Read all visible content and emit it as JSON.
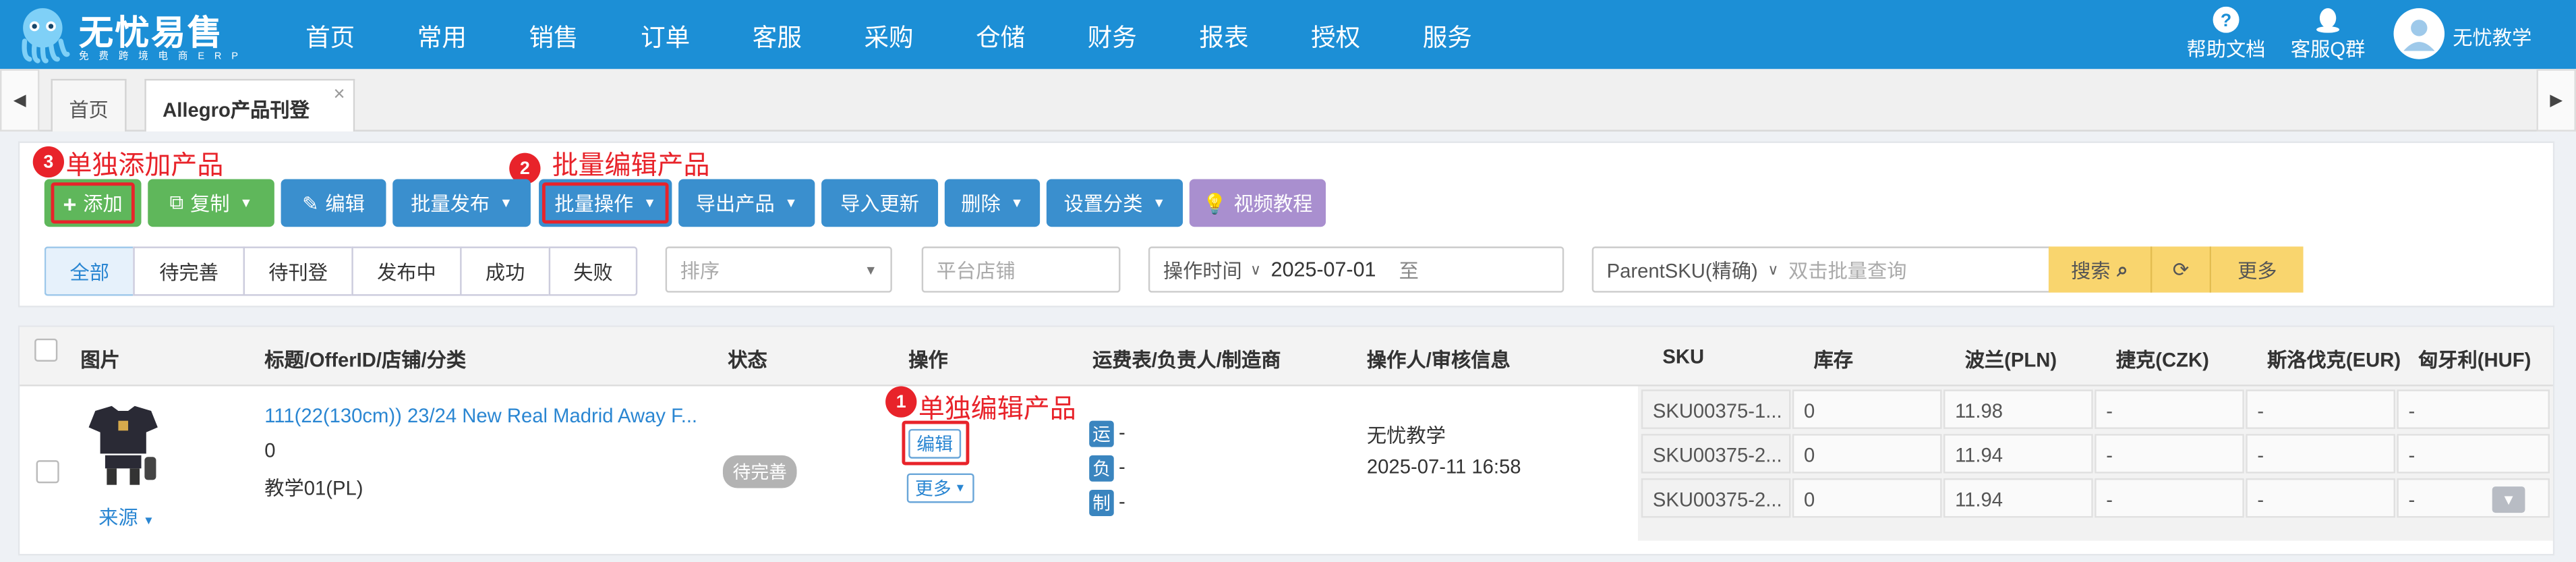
{
  "app": {
    "title": "无忧易售",
    "subtitle": "免 费 跨 境 电 商 E R P"
  },
  "nav": [
    "首页",
    "常用",
    "销售",
    "订单",
    "客服",
    "采购",
    "仓储",
    "财务",
    "报表",
    "授权",
    "服务"
  ],
  "right_nav": {
    "help": "帮助文档",
    "qq": "客服Q群",
    "user": "无忧教学"
  },
  "tabs": {
    "home": "首页",
    "active": "Allegro产品刊登",
    "close": "×"
  },
  "toolbar": {
    "add": "添加",
    "copy": "复制",
    "edit": "编辑",
    "batch_publish": "批量发布",
    "batch_ops": "批量操作",
    "export": "导出产品",
    "import_update": "导入更新",
    "delete": "删除",
    "set_category": "设置分类",
    "video": "视频教程"
  },
  "annotations": [
    {
      "num": "3",
      "text": "单独添加产品"
    },
    {
      "num": "2",
      "text": "批量编辑产品"
    },
    {
      "num": "1",
      "text": "单独编辑产品"
    }
  ],
  "status_tabs": [
    "全部",
    "待完善",
    "待刊登",
    "发布中",
    "成功",
    "失败"
  ],
  "filters": {
    "sort_placeholder": "排序",
    "shop_placeholder": "平台店铺",
    "time_label": "操作时间",
    "date_start": "2025-07-01",
    "date_sep": "至",
    "sku_type": "ParentSKU(精确)",
    "query_placeholder": "双击批量查询",
    "search": "搜索",
    "more": "更多"
  },
  "table": {
    "headers": [
      "图片",
      "标题/OfferID/店铺/分类",
      "状态",
      "操作",
      "运费表/负责人/制造商",
      "操作人/审核信息",
      "SKU",
      "库存",
      "波兰(PLN)",
      "捷克(CZK)",
      "斯洛伐克(EUR)",
      "匈牙利(HUF)"
    ],
    "row": {
      "title": "111(22(130cm)) 23/24 New Real Madrid Away F...",
      "offer_id": "0",
      "shop": "教学01(PL)",
      "source": "来源",
      "status": "待完善",
      "edit": "编辑",
      "more": "更多",
      "tags": [
        "运",
        "负",
        "制"
      ],
      "dash": "-",
      "operator": "无忧教学",
      "time": "2025-07-11 16:58"
    },
    "skus": [
      {
        "sku": "SKU00375-1...",
        "stock": "0",
        "pln": "11.98",
        "czk": "-",
        "eur": "-",
        "huf": "-"
      },
      {
        "sku": "SKU00375-2...",
        "stock": "0",
        "pln": "11.94",
        "czk": "-",
        "eur": "-",
        "huf": "-"
      },
      {
        "sku": "SKU00375-2...",
        "stock": "0",
        "pln": "11.94",
        "czk": "-",
        "eur": "-",
        "huf": "-"
      }
    ]
  },
  "colors": {
    "nav_bg": "#1c8fd6",
    "green": "#5fb75b",
    "blue": "#3a8fce",
    "purple": "#a98fcf",
    "annotation": "#e8232a",
    "search_btn": "#f9d56e"
  }
}
